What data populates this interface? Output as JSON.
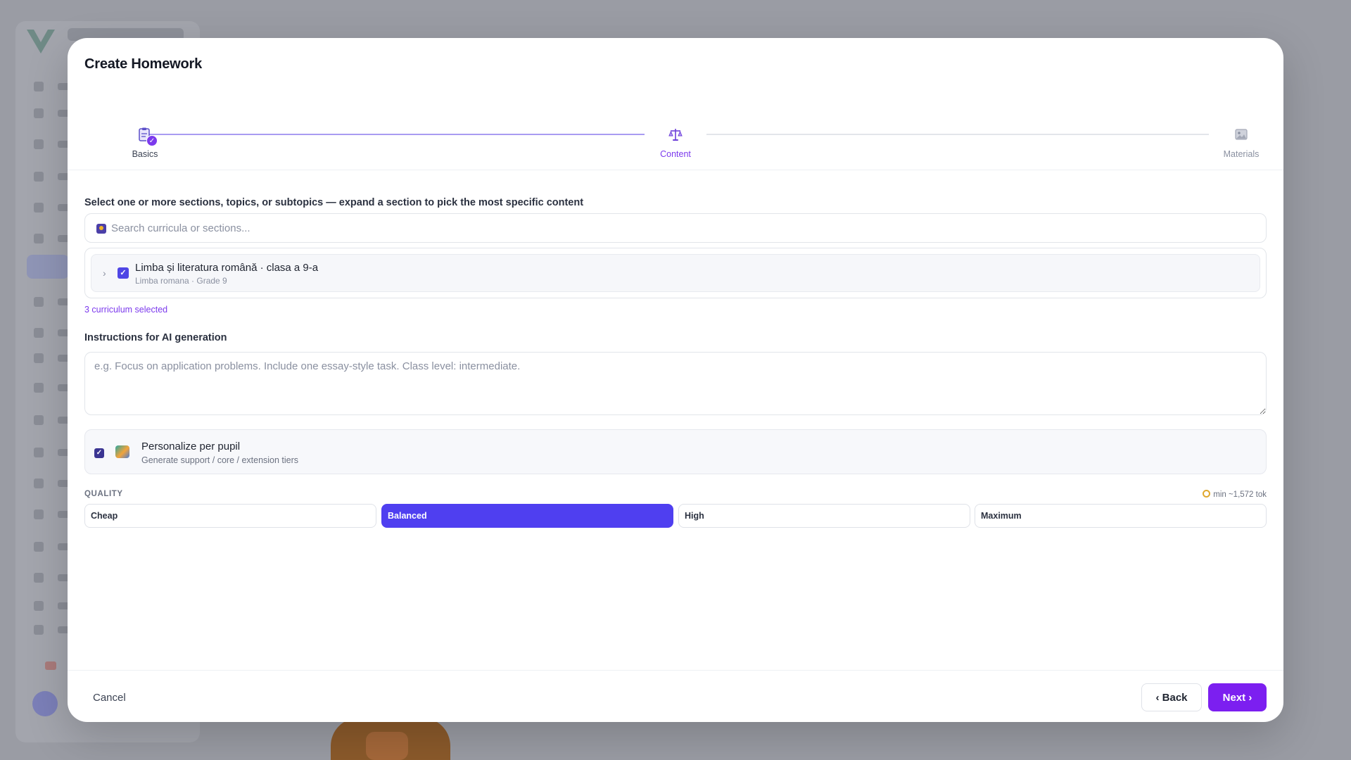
{
  "modal": {
    "title": "Create Homework"
  },
  "stepper": {
    "steps": [
      {
        "label": "Basics",
        "icon": "clipboard-icon",
        "state": "completed"
      },
      {
        "label": "Content",
        "icon": "scales-icon",
        "state": "active"
      },
      {
        "label": "Materials",
        "icon": "image-icon",
        "state": "upcoming"
      }
    ]
  },
  "content": {
    "section_label": "Select one or more sections, topics, or subtopics — expand a section to pick the most specific content",
    "search_placeholder": "Search curricula or sections...",
    "curricula": [
      {
        "title": "Limba și literatura română · clasa a 9-a",
        "subtitle": "Limba romana · Grade 9",
        "checked": true
      }
    ],
    "selected_count_text": "3 curriculum selected",
    "instructions_label": "Instructions for AI generation",
    "instructions_placeholder": "e.g. Focus on application problems. Include one essay-style task. Class level: intermediate.",
    "instructions_value": "",
    "personalize": {
      "title": "Personalize per pupil",
      "subtitle": "Generate support / core / extension tiers",
      "checked": true
    },
    "quality": {
      "label": "QUALITY",
      "token_estimate": "min ~1,572 tok",
      "options": [
        "Cheap",
        "Balanced",
        "High",
        "Maximum"
      ],
      "selected": "Balanced"
    }
  },
  "footer": {
    "cancel_label": "Cancel",
    "back_label": "Back",
    "next_label": "Next"
  },
  "colors": {
    "accent": "#7c3aed",
    "selected_quality": "#4f3ff0",
    "next_button": "#7c1ff0"
  }
}
